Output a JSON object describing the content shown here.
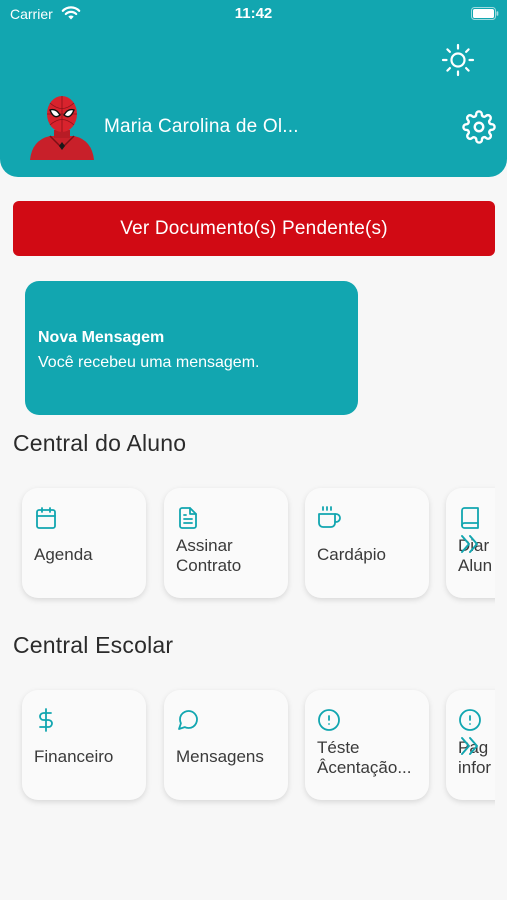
{
  "status_bar": {
    "carrier": "Carrier",
    "time": "11:42"
  },
  "header": {
    "user_name": "Maria Carolina de Ol..."
  },
  "pending_button": {
    "label": "Ver Documento(s) Pendente(s)"
  },
  "message": {
    "title": "Nova Mensagem",
    "body": "Você recebeu uma mensagem."
  },
  "central_aluno": {
    "title": "Central do Aluno",
    "items": [
      {
        "label": "Agenda",
        "icon": "calendar-icon"
      },
      {
        "label": "Assinar",
        "label2": "Contrato",
        "icon": "document-icon"
      },
      {
        "label": "Cardápio",
        "icon": "coffee-cup-icon"
      },
      {
        "label": "Diar",
        "label2": "Alun",
        "icon": "book-icon"
      }
    ]
  },
  "central_escolar": {
    "title": "Central Escolar",
    "items": [
      {
        "label": "Financeiro",
        "icon": "dollar-icon"
      },
      {
        "label": "Mensagens",
        "icon": "chat-bubble-icon"
      },
      {
        "label": "Téste",
        "label2": "Âcentação...",
        "icon": "alert-circle-icon"
      },
      {
        "label": "Pag",
        "label2": "infor",
        "icon": "alert-circle-icon"
      }
    ]
  },
  "colors": {
    "brand": "#12a6b0",
    "alert": "#d10a14",
    "icon": "#12a6b0"
  }
}
